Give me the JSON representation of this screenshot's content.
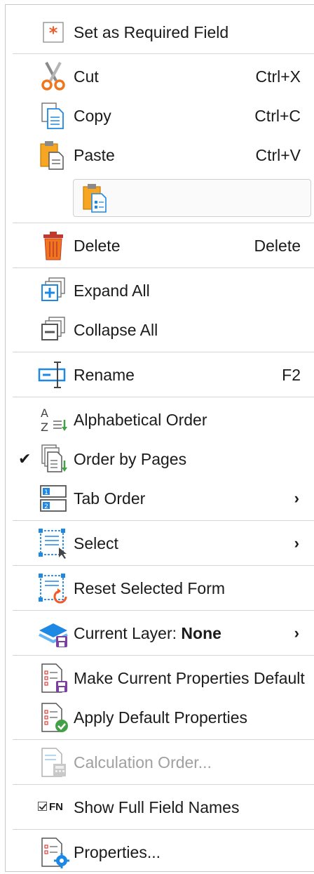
{
  "menu": {
    "set_required": "Set as Required Field",
    "cut": {
      "label": "Cut",
      "shortcut": "Ctrl+X"
    },
    "copy": {
      "label": "Copy",
      "shortcut": "Ctrl+C"
    },
    "paste": {
      "label": "Paste",
      "shortcut": "Ctrl+V"
    },
    "delete": {
      "label": "Delete",
      "shortcut": "Delete"
    },
    "expand_all": "Expand All",
    "collapse_all": "Collapse All",
    "rename": {
      "label": "Rename",
      "shortcut": "F2"
    },
    "alphabetical_order": "Alphabetical Order",
    "order_by_pages": {
      "label": "Order by Pages",
      "check": "✔"
    },
    "tab_order": {
      "label": "Tab Order",
      "arrow": "›"
    },
    "select": {
      "label": "Select",
      "arrow": "›"
    },
    "reset_selected_form": "Reset Selected Form",
    "current_layer": {
      "label": "Current Layer: ",
      "value": "None",
      "arrow": "›"
    },
    "make_default": "Make Current Properties Default",
    "apply_default": "Apply Default Properties",
    "calculation_order": "Calculation Order...",
    "show_full_names": {
      "label": "Show Full Field Names",
      "icon_text": "FN"
    },
    "properties": "Properties..."
  },
  "colors": {
    "accent_blue": "#1e88e5",
    "orange": "#f0761e",
    "red": "#e53935",
    "green": "#43a047"
  }
}
